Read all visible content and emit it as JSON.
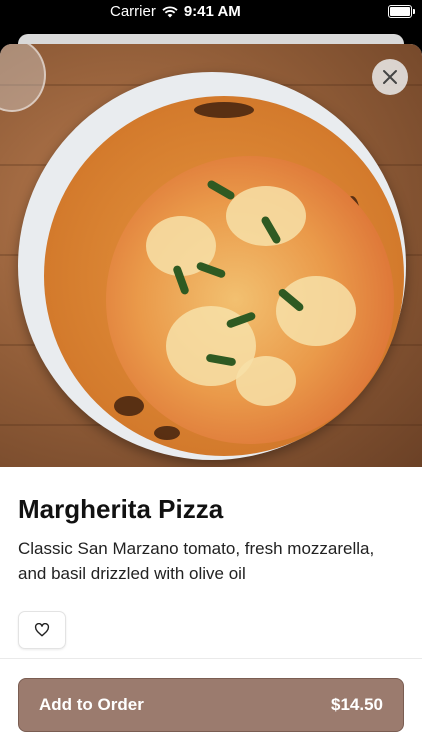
{
  "status_bar": {
    "carrier": "Carrier",
    "time": "9:41 AM"
  },
  "item": {
    "title": "Margherita Pizza",
    "description": "Classic San Marzano tomato, fresh mozzarella, and basil drizzled with olive oil"
  },
  "actions": {
    "add_label": "Add to Order",
    "price": "$14.50"
  },
  "icons": {
    "close": "close-icon",
    "favorite": "heart-icon",
    "wifi": "wifi-icon",
    "battery": "battery-icon"
  },
  "colors": {
    "button_bg": "#9b7b6e",
    "button_border": "#7a5d52"
  }
}
